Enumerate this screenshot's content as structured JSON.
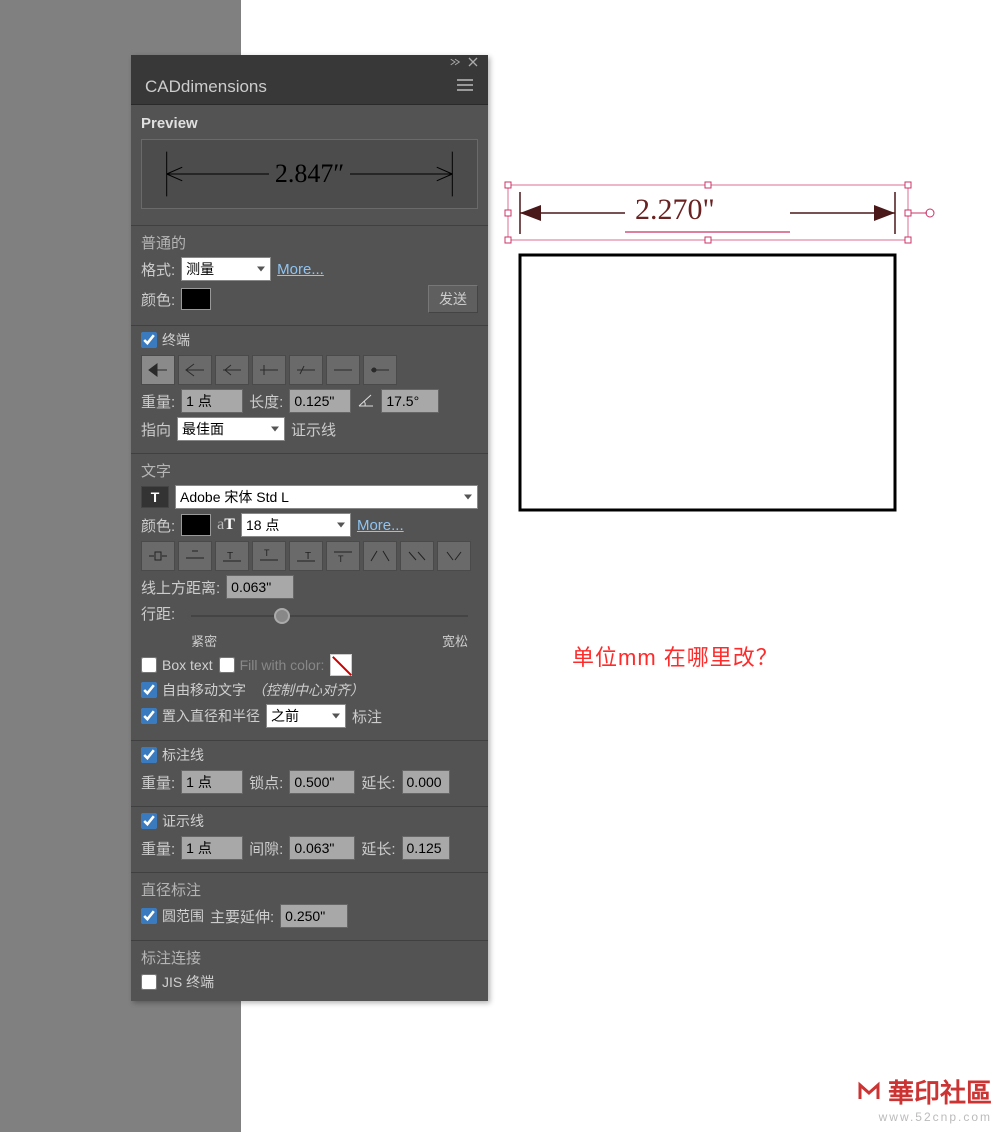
{
  "panel": {
    "title": "CADdimensions"
  },
  "preview": {
    "label": "Preview",
    "value": "2.847″"
  },
  "normal": {
    "title": "普通的",
    "format_label": "格式:",
    "format_value": "测量",
    "more": "More...",
    "color_label": "颜色:",
    "send_button": "发送"
  },
  "terminal": {
    "label": "终端",
    "weight_label": "重量:",
    "weight_value": "1 点",
    "length_label": "长度:",
    "length_value": "0.125\"",
    "angle_value": "17.5°",
    "orient_label": "指向",
    "orient_value": "最佳面",
    "witness_label": "证示线"
  },
  "text": {
    "title": "文字",
    "font_value": "Adobe 宋体 Std L",
    "color_label": "颜色:",
    "size_value": "18 点",
    "more": "More...",
    "above_label": "线上方距离:",
    "above_value": "0.063\"",
    "lead_label": "行距:",
    "tight_label": "紧密",
    "loose_label": "宽松",
    "box_label": "Box text",
    "fill_label": "Fill with color:",
    "freemove_label": "自由移动文字",
    "freemove_hint": "（控制中心对齐）",
    "insert_label": "置入直径和半径",
    "insert_value": "之前",
    "anno_label": "标注"
  },
  "dimline": {
    "title": "标注线",
    "weight_label": "重量:",
    "weight_value": "1 点",
    "lock_label": "锁点:",
    "lock_value": "0.500\"",
    "ext_label": "延长:",
    "ext_value": "0.000"
  },
  "witness": {
    "title": "证示线",
    "weight_label": "重量:",
    "weight_value": "1 点",
    "gap_label": "间隙:",
    "gap_value": "0.063\"",
    "ext_label": "延长:",
    "ext_value": "0.125"
  },
  "diameter": {
    "title": "直径标注",
    "circle_label": "圆范围",
    "main_label": "主要延伸:",
    "main_value": "0.250\""
  },
  "connect": {
    "title": "标注连接",
    "jis_label": "JIS 终端"
  },
  "canvas": {
    "dim_text": "2.270\""
  },
  "question": "单位mm  在哪里改？",
  "watermark": {
    "main": "華印社區",
    "sub": "www.52cnp.com"
  }
}
